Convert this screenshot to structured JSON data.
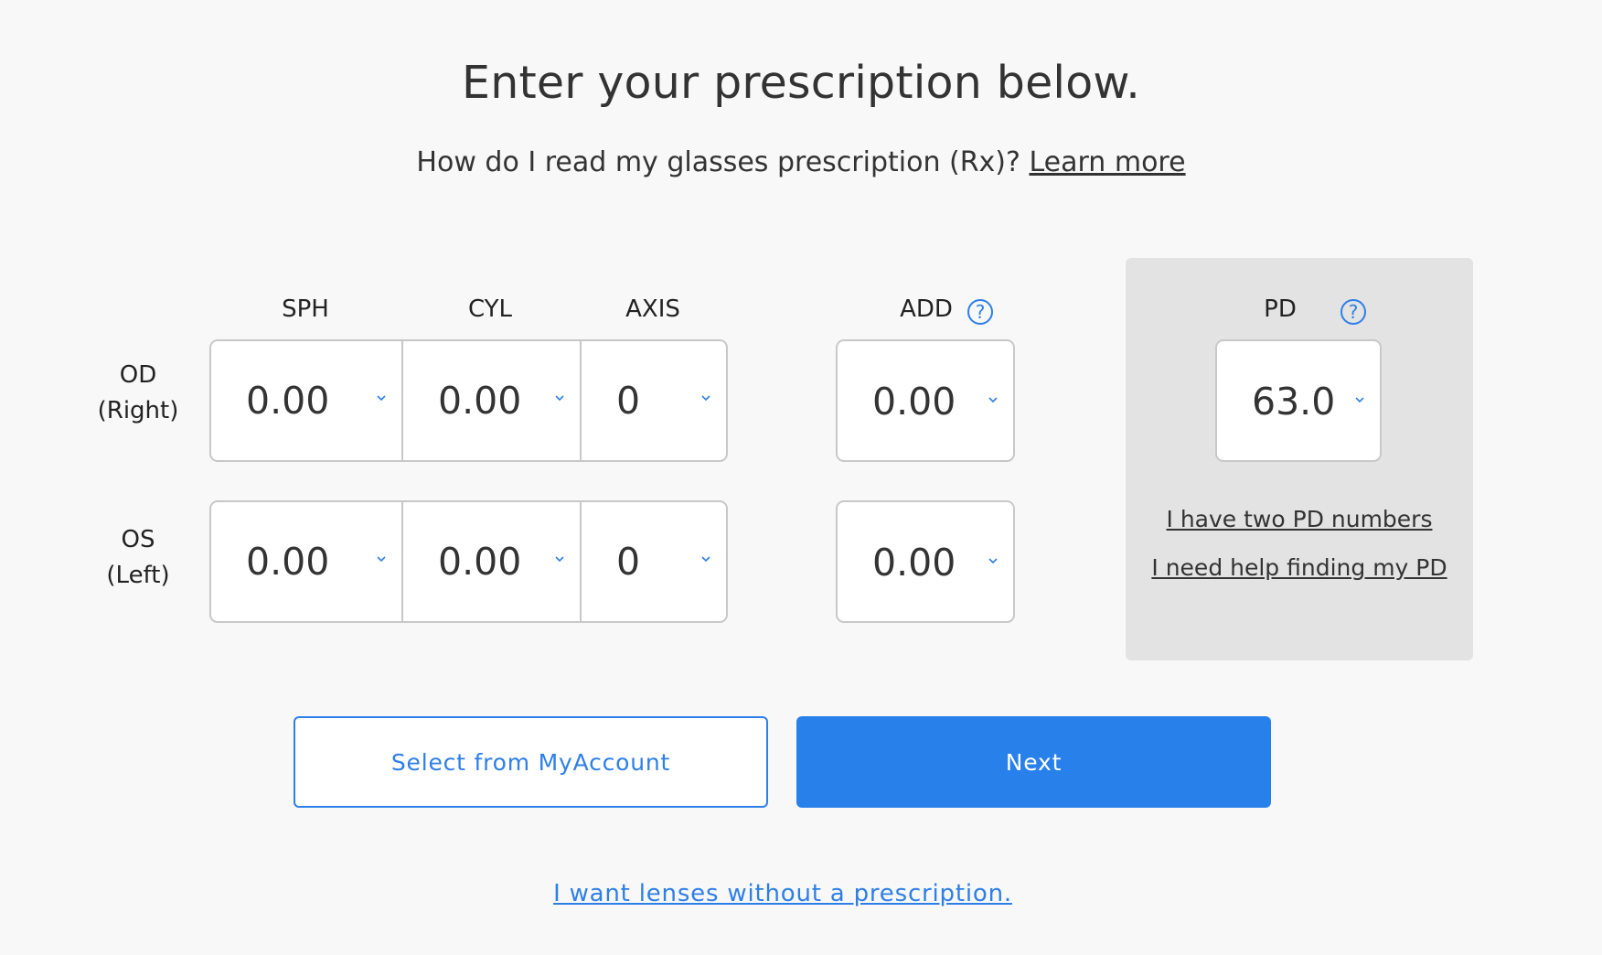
{
  "header": {
    "title": "Enter your prescription below.",
    "subtitle": "How do I read my glasses prescription (Rx)?",
    "learn_more": "Learn more"
  },
  "columns": {
    "sph": "SPH",
    "cyl": "CYL",
    "axis": "AXIS",
    "add": "ADD",
    "pd": "PD"
  },
  "rows": {
    "od": {
      "label_line1": "OD",
      "label_line2": "(Right)",
      "sph": "0.00",
      "cyl": "0.00",
      "axis": "0",
      "add": "0.00"
    },
    "os": {
      "label_line1": "OS",
      "label_line2": "(Left)",
      "sph": "0.00",
      "cyl": "0.00",
      "axis": "0",
      "add": "0.00"
    }
  },
  "pd": {
    "value": "63.0",
    "two_numbers_link": "I have two PD numbers",
    "help_link": "I need help finding my PD"
  },
  "icons": {
    "help": "help-circle-icon",
    "help_glyph": "?",
    "dropdown": "chevron-down-icon"
  },
  "actions": {
    "select_account": "Select from MyAccount",
    "next": "Next",
    "no_prescription": "I want lenses without a prescription."
  },
  "colors": {
    "accent": "#2880ea",
    "background": "#f8f8f8",
    "pd_panel": "#e3e3e3",
    "border": "#c8c8c8"
  }
}
